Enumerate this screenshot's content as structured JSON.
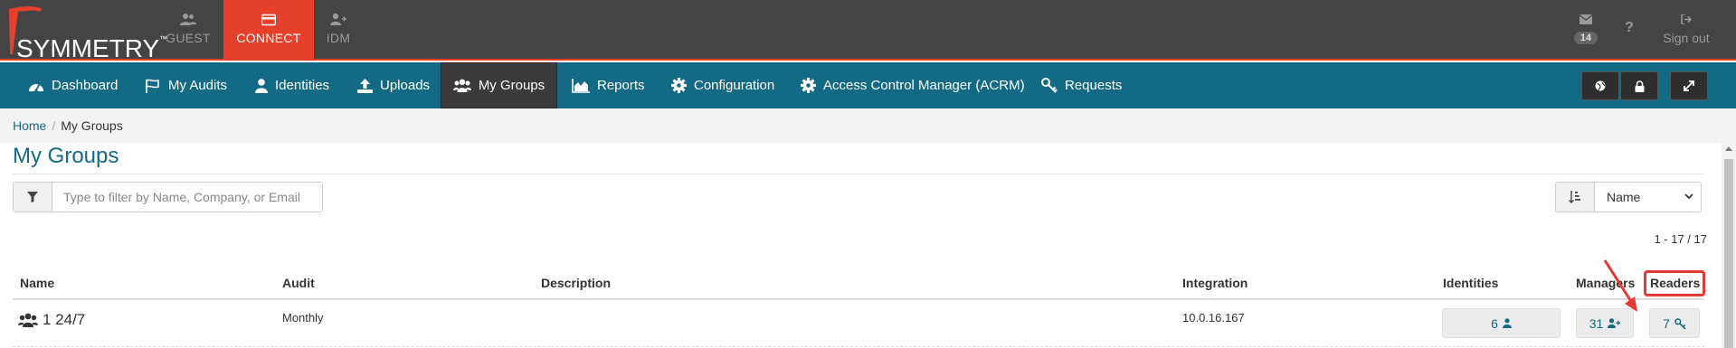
{
  "brand": {
    "logo_text": "SYMMETRY",
    "logo_tm": "™"
  },
  "apps": [
    {
      "label": "GUEST",
      "icon": "users-icon"
    },
    {
      "label": "CONNECT",
      "icon": "credit-card-icon"
    },
    {
      "label": "IDM",
      "icon": "user-plus-icon"
    }
  ],
  "top_right": {
    "mail_count": "14",
    "help": "?",
    "sign_out": "Sign out"
  },
  "nav": {
    "items": [
      {
        "label": "Dashboard",
        "icon": "dashboard-icon"
      },
      {
        "label": "My Audits",
        "icon": "flag-icon"
      },
      {
        "label": "Identities",
        "icon": "user-icon"
      },
      {
        "label": "Uploads",
        "icon": "upload-icon"
      },
      {
        "label": "My Groups",
        "icon": "users-icon"
      },
      {
        "label": "Reports",
        "icon": "area-chart-icon"
      },
      {
        "label": "Configuration",
        "icon": "gear-icon"
      },
      {
        "label": "Access Control Manager (ACRM)",
        "icon": "gear-icon"
      },
      {
        "label": "Requests",
        "icon": "key-icon"
      }
    ],
    "active": "My Groups"
  },
  "breadcrumb": {
    "home": "Home",
    "separator": "/",
    "current": "My Groups"
  },
  "page": {
    "title": "My Groups",
    "filter_placeholder": "Type to filter by Name, Company, or Email",
    "sort_value": "Name",
    "count": "1 - 17 / 17"
  },
  "table": {
    "headers": {
      "name": "Name",
      "audit": "Audit",
      "description": "Description",
      "integration": "Integration",
      "identities": "Identities",
      "managers": "Managers",
      "readers": "Readers"
    },
    "rows": [
      {
        "name": "1 24/7",
        "audit": "Monthly",
        "description": "",
        "integration": "10.0.16.167",
        "identities": "6",
        "managers": "31",
        "readers": "7"
      }
    ]
  },
  "colors": {
    "topbar": "#444444",
    "accent_red": "#e5402a",
    "nav_teal": "#136a85",
    "annotation_red": "#e53935"
  }
}
